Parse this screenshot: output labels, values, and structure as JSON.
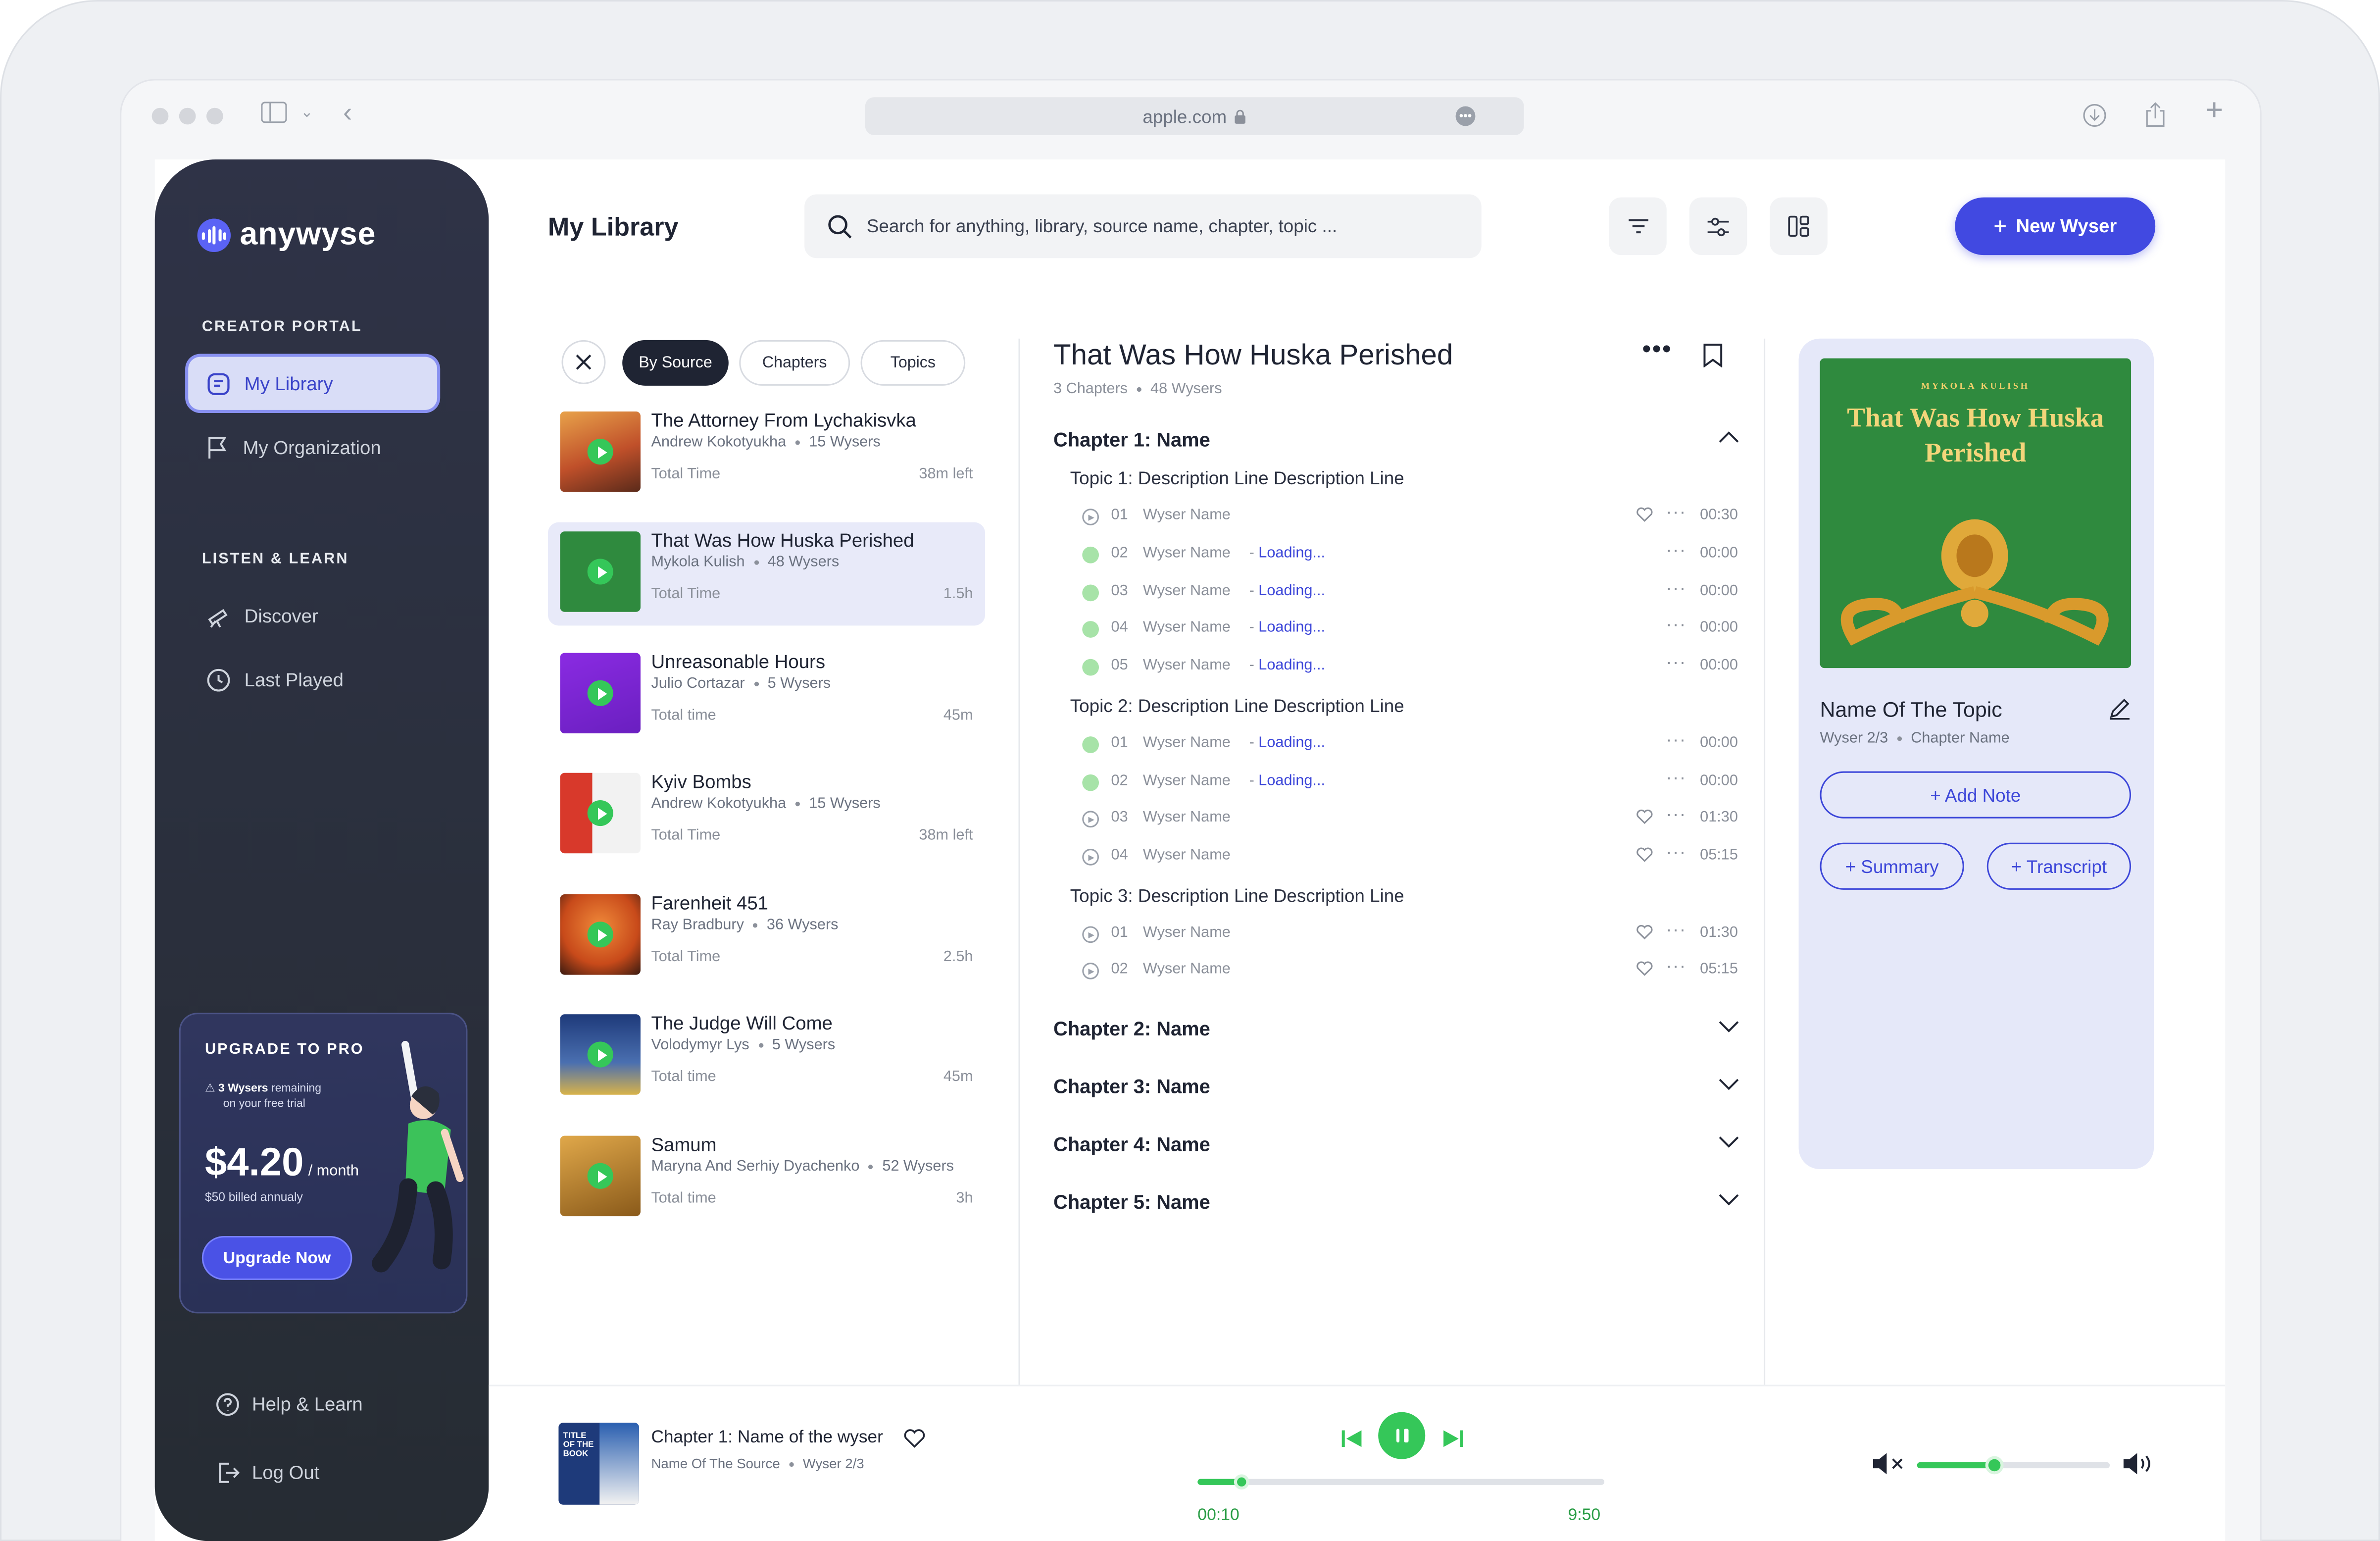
{
  "browser": {
    "url": "apple.com"
  },
  "brand": {
    "name": "anywyse",
    "accent": "#4149e1",
    "green": "#35c759"
  },
  "sidebar": {
    "creator_label": "CREATOR PORTAL",
    "my_library": "My Library",
    "my_organization": "My Organization",
    "listen_label": "LISTEN & LEARN",
    "discover": "Discover",
    "last_played": "Last Played",
    "help": "Help & Learn",
    "logout": "Log Out"
  },
  "upgrade": {
    "title": "UPGRADE TO PRO",
    "remaining_count": "3 Wysers",
    "remaining_rest": "remaining",
    "remaining_line2": "on your free trial",
    "price": "$4.20",
    "per": "/ month",
    "billed": "$50 billed annualy",
    "button": "Upgrade Now"
  },
  "header": {
    "title": "My Library",
    "search_placeholder": "Search for anything, library, source name, chapter, topic ...",
    "new_button": "New Wyser"
  },
  "filters": {
    "by_source": "By Source",
    "chapters": "Chapters",
    "topics": "Topics"
  },
  "sources": [
    {
      "title": "The Attorney From Lychakisvka",
      "author": "Andrew Kokotyukha",
      "wysers": "15 Wysers",
      "label": "Total Time",
      "time": "38m left"
    },
    {
      "title": "That Was How Huska Perished",
      "author": "Mykola Kulish",
      "wysers": "48 Wysers",
      "label": "Total Time",
      "time": "1.5h"
    },
    {
      "title": "Unreasonable Hours",
      "author": "Julio Cortazar",
      "wysers": "5 Wysers",
      "label": "Total time",
      "time": "45m"
    },
    {
      "title": "Kyiv Bombs",
      "author": "Andrew Kokotyukha",
      "wysers": "15 Wysers",
      "label": "Total Time",
      "time": "38m left"
    },
    {
      "title": "Farenheit 451",
      "author": "Ray Bradbury",
      "wysers": "36 Wysers",
      "label": "Total Time",
      "time": "2.5h"
    },
    {
      "title": "The Judge Will Come",
      "author": "Volodymyr Lys",
      "wysers": "5 Wysers",
      "label": "Total time",
      "time": "45m"
    },
    {
      "title": "Samum",
      "author": "Maryna And Serhiy Dyachenko",
      "wysers": "52 Wysers",
      "label": "Total time",
      "time": "3h"
    }
  ],
  "detail": {
    "title": "That Was How Huska Perished",
    "chapters_count": "3 Chapters",
    "wysers_count": "48 Wysers",
    "chapter1": "Chapter 1: Name",
    "topic1": "Topic 1: Description Line Description Line",
    "topic2": "Topic 2: Description Line Description Line",
    "topic3": "Topic 3: Description Line Description Line",
    "rows": [
      {
        "num": "01",
        "name": "Wyser Name",
        "loading": "",
        "dur": "00:30"
      },
      {
        "num": "02",
        "name": "Wyser Name",
        "loading": "Loading...",
        "dur": "00:00"
      },
      {
        "num": "03",
        "name": "Wyser Name",
        "loading": "Loading...",
        "dur": "00:00"
      },
      {
        "num": "04",
        "name": "Wyser Name",
        "loading": "Loading...",
        "dur": "00:00"
      },
      {
        "num": "05",
        "name": "Wyser Name",
        "loading": "Loading...",
        "dur": "00:00"
      },
      {
        "num": "01",
        "name": "Wyser Name",
        "loading": "Loading...",
        "dur": "00:00"
      },
      {
        "num": "02",
        "name": "Wyser Name",
        "loading": "Loading...",
        "dur": "00:00"
      },
      {
        "num": "03",
        "name": "Wyser Name",
        "loading": "",
        "dur": "01:30"
      },
      {
        "num": "04",
        "name": "Wyser Name",
        "loading": "",
        "dur": "05:15"
      },
      {
        "num": "01",
        "name": "Wyser Name",
        "loading": "",
        "dur": "01:30"
      },
      {
        "num": "02",
        "name": "Wyser Name",
        "loading": "",
        "dur": "05:15"
      }
    ],
    "chapter2": "Chapter 2: Name",
    "chapter3": "Chapter 3: Name",
    "chapter4": "Chapter 4: Name",
    "chapter5": "Chapter 5: Name"
  },
  "panel": {
    "cover_author": "MYKOLA KULISH",
    "cover_title": "That Was How Huska Perished",
    "topic_name": "Name Of The Topic",
    "wyser": "Wyser 2/3",
    "chapter": "Chapter Name",
    "add_note": "+ Add Note",
    "summary": "+ Summary",
    "transcript": "+ Transcript"
  },
  "player": {
    "title": "Chapter 1: Name of the wyser",
    "source": "Name Of The Source",
    "wyser": "Wyser 2/3",
    "cover_text": "TITLE OF THE BOOK",
    "current": "00:10",
    "total": "9:50",
    "progress": 0.11,
    "volume": 0.4
  }
}
